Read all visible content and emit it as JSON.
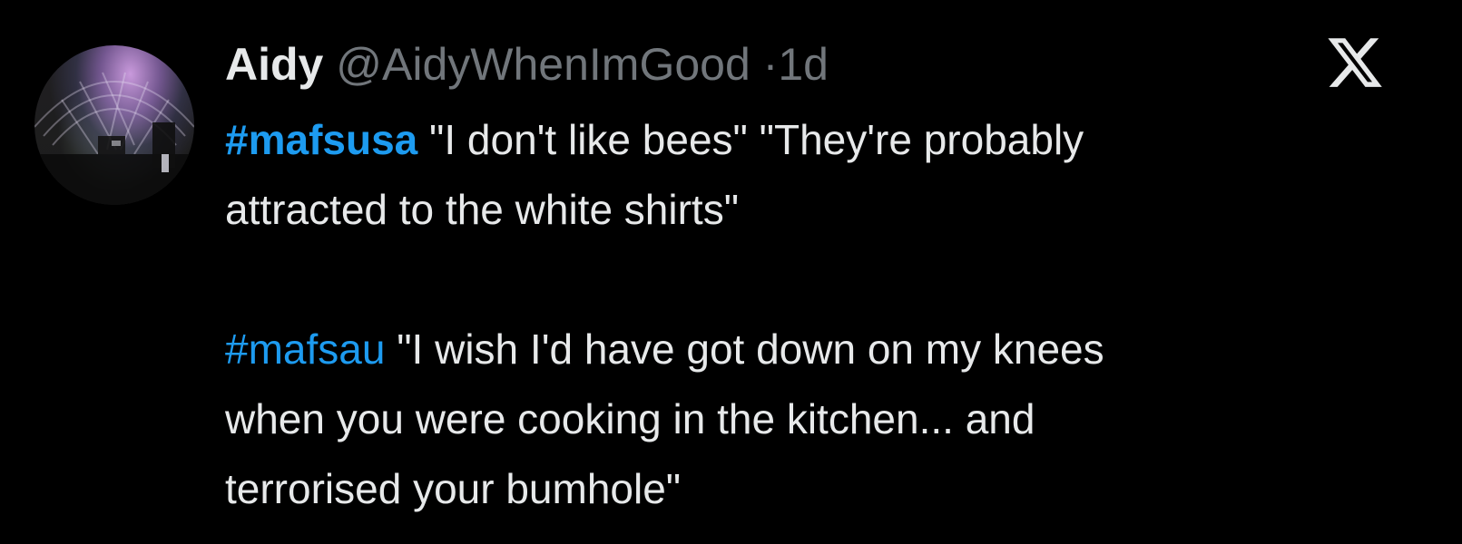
{
  "tweet": {
    "author": {
      "name": "Aidy",
      "handle": "@AidyWhenImGood",
      "separator": "·",
      "time": "1d"
    },
    "platform_icon": "x-logo-icon",
    "paragraphs": [
      {
        "hashtag": "#mafsusa",
        "text_line1": " \"I don't like bees\" \"They're probably",
        "text_line2": "attracted to the white shirts\""
      },
      {
        "hashtag": "#mafsau",
        "text_line1": " \"I wish I'd have got down on my knees",
        "text_line2": "when you were cooking in the kitchen... and",
        "text_line3": "terrorised your bumhole\""
      }
    ]
  },
  "colors": {
    "background": "#000000",
    "text": "#e7e9ea",
    "muted": "#71767b",
    "hashtag": "#1d9bf0"
  }
}
